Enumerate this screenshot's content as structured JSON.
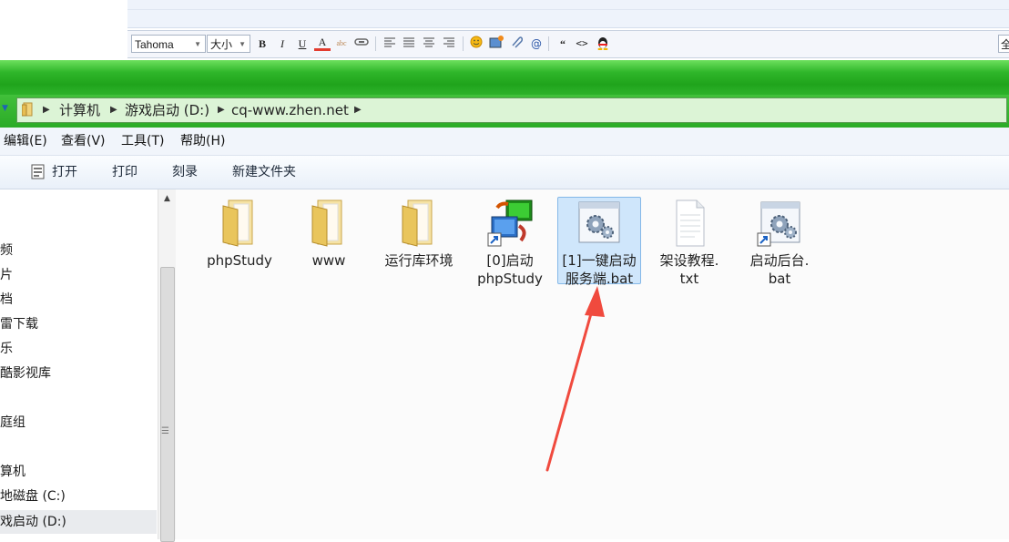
{
  "editor": {
    "font_family": "Tahoma",
    "font_size": "大小",
    "select_all": "全",
    "buttons": [
      "B",
      "I",
      "U",
      "A",
      "abc"
    ]
  },
  "address": {
    "crumbs": [
      "计算机",
      "游戏启动 (D:)",
      "cq-www.zhen.net"
    ]
  },
  "menu": [
    "编辑(E)",
    "查看(V)",
    "工具(T)",
    "帮助(H)"
  ],
  "commands": [
    "打开",
    "打印",
    "刻录",
    "新建文件夹"
  ],
  "nav_items": [
    "视频",
    "图片",
    "文档",
    "迅雷下载",
    "音乐",
    "优酷影视库",
    "家庭组",
    "计算机",
    "本地磁盘 (C:)",
    "游戏启动 (D:)"
  ],
  "nav_visible": [
    "频",
    "片",
    "档",
    "雷下载",
    "乐",
    "酷影视库",
    "庭组",
    "算机",
    "地磁盘 (C:)",
    "戏启动 (D:)"
  ],
  "files": [
    {
      "name": "phpStudy",
      "line2": "",
      "icon": "folder-icon"
    },
    {
      "name": "www",
      "line2": "",
      "icon": "folder-icon"
    },
    {
      "name": "运行库环境",
      "line2": "",
      "icon": "folder-icon"
    },
    {
      "name": "[0]启动",
      "line2": "phpStudy",
      "icon": "shortcut-app-icon"
    },
    {
      "name": "[1]一键启动",
      "line2": "服务端.bat",
      "icon": "bat-gear-icon"
    },
    {
      "name": "架设教程.",
      "line2": "txt",
      "icon": "text-file-icon"
    },
    {
      "name": "启动后台.",
      "line2": "bat",
      "icon": "bat-shortcut-icon"
    }
  ],
  "colors": {
    "explorer_green": "#2fb62a",
    "selection": "#cfe6fb",
    "annotation_arrow": "#f04a3e"
  }
}
